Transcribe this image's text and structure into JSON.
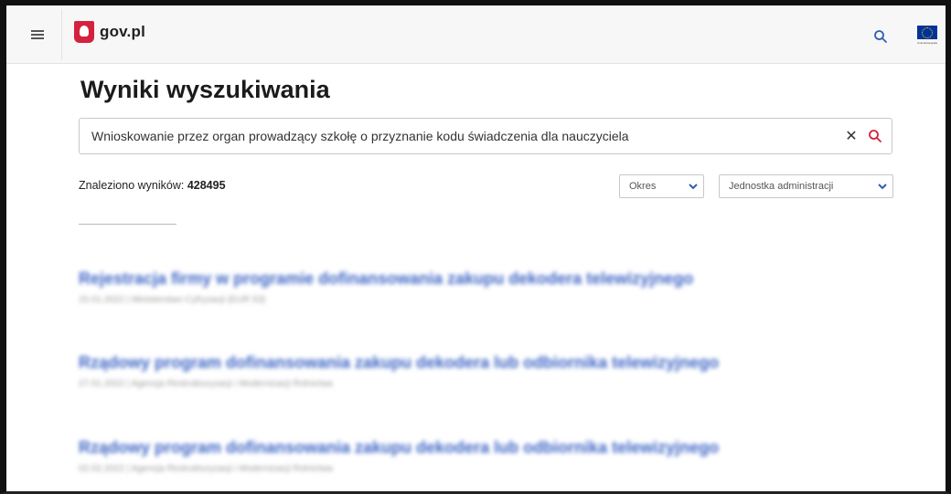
{
  "header": {
    "logo_text": "gov.pl",
    "menu_icon": "hamburger-menu-icon",
    "search_icon": "search-icon",
    "eu_flag_icon": "eu-flag-icon",
    "accent_color": "#d4213d"
  },
  "main": {
    "title": "Wyniki wyszukiwania",
    "search": {
      "value": "Wnioskowanie przez organ prowadzący szkołę o przyznanie kodu świadczenia dla nauczyciela",
      "clear_icon": "close-icon",
      "submit_icon": "search-icon"
    },
    "results_count_label": "Znaleziono wyników:",
    "results_count": "428495",
    "filters": [
      {
        "label": "Okres",
        "icon": "chevron-down-icon"
      },
      {
        "label": "Jednostka administracji",
        "icon": "chevron-down-icon"
      }
    ],
    "results": [
      {
        "title": "Rejestracja firmy w programie dofinansowania zakupu dekodera telewizyjnego",
        "meta": "15.01.2022 | Ministerstwo Cyfryzacji (EUR 53)"
      },
      {
        "title": "Rządowy program dofinansowania zakupu dekodera lub odbiornika telewizyjnego",
        "meta": "27.01.2022 | Agencja Restrukturyzacji i Modernizacji Rolnictwa"
      },
      {
        "title": "Rządowy program dofinansowania zakupu dekodera lub odbiornika telewizyjnego",
        "meta": "02.02.2022 | Agencja Restrukturyzacji i Modernizacji Rolnictwa"
      }
    ],
    "link_color": "#3f66c6"
  }
}
